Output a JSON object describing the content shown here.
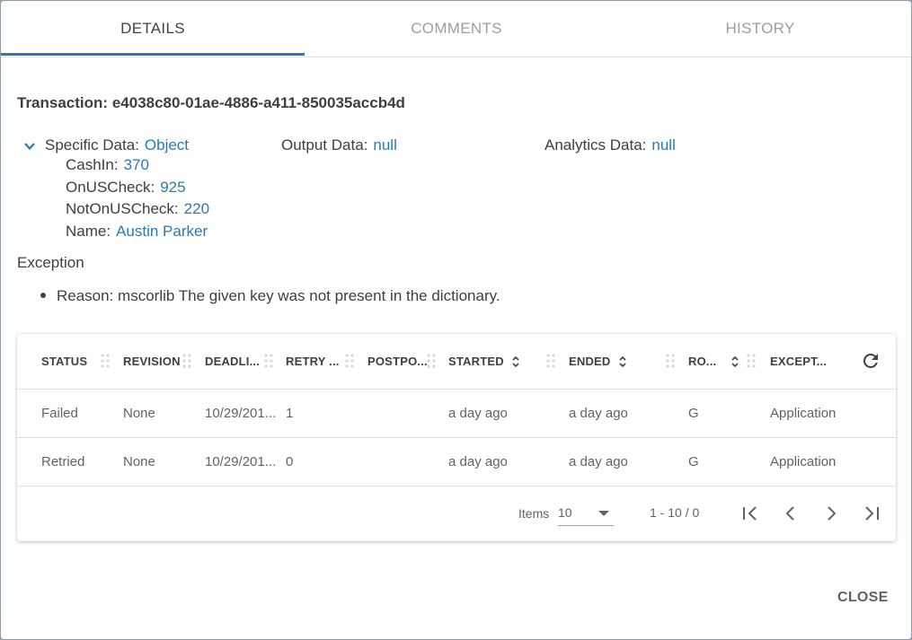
{
  "tabs": [
    {
      "label": "DETAILS",
      "active": true
    },
    {
      "label": "COMMENTS",
      "active": false
    },
    {
      "label": "HISTORY",
      "active": false
    }
  ],
  "transaction": {
    "label": "Transaction:",
    "id": "e4038c80-01ae-4886-a411-850035accb4d"
  },
  "specific_data": {
    "label": "Specific Data:",
    "value": "Object",
    "fields": [
      {
        "label": "CashIn:",
        "value": "370"
      },
      {
        "label": "OnUSCheck:",
        "value": "925"
      },
      {
        "label": "NotOnUSCheck:",
        "value": "220"
      },
      {
        "label": "Name:",
        "value": "Austin Parker"
      }
    ]
  },
  "output_data": {
    "label": "Output Data:",
    "value": "null"
  },
  "analytics_data": {
    "label": "Analytics Data:",
    "value": "null"
  },
  "exception": {
    "title": "Exception",
    "reason": "Reason: mscorlib The given key was not present in the dictionary."
  },
  "grid": {
    "columns": [
      "STATUS",
      "REVISION",
      "DEADLI...",
      "RETRY ...",
      "POSTPO...",
      "STARTED",
      "ENDED",
      "RO...",
      "EXCEPT..."
    ],
    "rows": [
      [
        "Failed",
        "None",
        "10/29/201...",
        "1",
        "",
        "a day ago",
        "a day ago",
        "G",
        "Application"
      ],
      [
        "Retried",
        "None",
        "10/29/201...",
        "0",
        "",
        "a day ago",
        "a day ago",
        "G",
        "Application"
      ]
    ],
    "pager": {
      "items_label": "Items",
      "page_size": "10",
      "range": "1 - 10 / 0"
    }
  },
  "actions": {
    "close_label": "CLOSE"
  },
  "colors": {
    "accent": "#2b78b8",
    "text": "#3c4043",
    "muted": "#9e9e9e"
  },
  "icons": [
    "chevron-down-icon",
    "drag-handle-icon",
    "sort-icon",
    "refresh-icon",
    "first-page-icon",
    "prev-page-icon",
    "next-page-icon",
    "last-page-icon"
  ]
}
